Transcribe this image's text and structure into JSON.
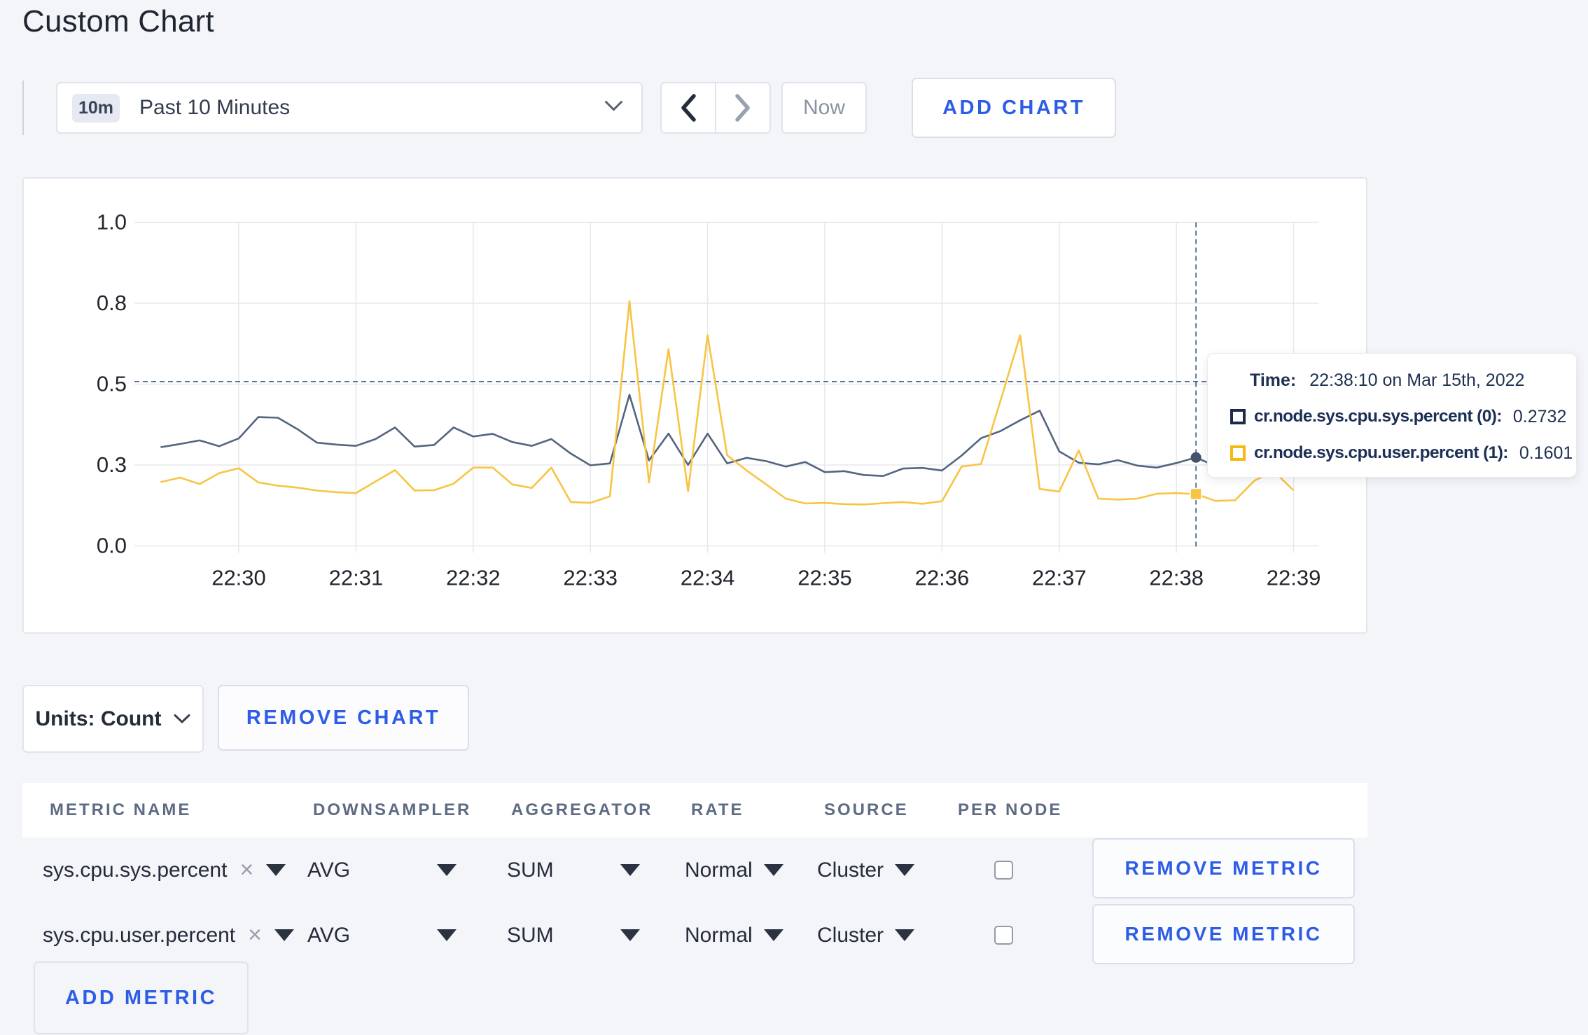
{
  "page": {
    "title": "Custom Chart"
  },
  "toolbar": {
    "range_badge": "10m",
    "range_label": "Past 10 Minutes",
    "now_label": "Now",
    "add_chart_label": "ADD CHART"
  },
  "controls": {
    "units_label": "Units: Count",
    "remove_chart_label": "REMOVE CHART",
    "add_metric_label": "ADD METRIC"
  },
  "tooltip": {
    "time_label": "Time:",
    "time_value": "22:38:10 on Mar 15th, 2022",
    "series": [
      {
        "label": "cr.node.sys.cpu.sys.percent (0):",
        "value": "0.2732",
        "swatch_color": "#1b2b4a"
      },
      {
        "label": "cr.node.sys.cpu.user.percent (1):",
        "value": "0.1601",
        "swatch_color": "#f5b912"
      }
    ]
  },
  "table": {
    "headers": [
      "METRIC NAME",
      "DOWNSAMPLER",
      "AGGREGATOR",
      "RATE",
      "SOURCE",
      "PER NODE"
    ],
    "remove_metric_label": "REMOVE METRIC",
    "rows": [
      {
        "metric": "sys.cpu.sys.percent",
        "downsampler": "AVG",
        "aggregator": "SUM",
        "rate": "Normal",
        "source": "Cluster",
        "per_node_checked": false
      },
      {
        "metric": "sys.cpu.user.percent",
        "downsampler": "AVG",
        "aggregator": "SUM",
        "rate": "Normal",
        "source": "Cluster",
        "per_node_checked": false
      }
    ]
  },
  "chart_data": {
    "type": "line",
    "title": "",
    "xlabel": "",
    "ylabel": "",
    "ylim": [
      0,
      1
    ],
    "grid": true,
    "yticks": {
      "values": [
        0,
        0.25,
        0.5,
        0.75,
        1.0
      ],
      "labels": [
        "0.0",
        "0.3",
        "0.5",
        "0.8",
        "1.0"
      ]
    },
    "xticks": [
      "22:30",
      "22:31",
      "22:32",
      "22:33",
      "22:34",
      "22:35",
      "22:36",
      "22:37",
      "22:38",
      "22:39"
    ],
    "x_times": [
      "22:29:20",
      "22:29:30",
      "22:29:40",
      "22:29:50",
      "22:30:00",
      "22:30:10",
      "22:30:20",
      "22:30:30",
      "22:30:40",
      "22:30:50",
      "22:31:00",
      "22:31:10",
      "22:31:20",
      "22:31:30",
      "22:31:40",
      "22:31:50",
      "22:32:00",
      "22:32:10",
      "22:32:20",
      "22:32:30",
      "22:32:40",
      "22:32:50",
      "22:33:00",
      "22:33:10",
      "22:33:20",
      "22:33:30",
      "22:33:40",
      "22:33:50",
      "22:34:00",
      "22:34:10",
      "22:34:20",
      "22:34:30",
      "22:34:40",
      "22:34:50",
      "22:35:00",
      "22:35:10",
      "22:35:20",
      "22:35:30",
      "22:35:40",
      "22:35:50",
      "22:36:00",
      "22:36:10",
      "22:36:20",
      "22:36:30",
      "22:36:40",
      "22:36:50",
      "22:37:00",
      "22:37:10",
      "22:37:20",
      "22:37:30",
      "22:37:40",
      "22:37:50",
      "22:38:00",
      "22:38:10",
      "22:38:20",
      "22:38:30",
      "22:38:40",
      "22:38:50",
      "22:39:00"
    ],
    "series": [
      {
        "name": "cr.node.sys.cpu.sys.percent (0)",
        "color": "#53657f",
        "values": [
          0.305,
          0.315,
          0.326,
          0.308,
          0.332,
          0.398,
          0.396,
          0.361,
          0.319,
          0.313,
          0.309,
          0.33,
          0.366,
          0.307,
          0.312,
          0.366,
          0.338,
          0.346,
          0.321,
          0.309,
          0.33,
          0.285,
          0.249,
          0.255,
          0.467,
          0.264,
          0.347,
          0.25,
          0.347,
          0.255,
          0.272,
          0.262,
          0.245,
          0.259,
          0.228,
          0.231,
          0.219,
          0.216,
          0.239,
          0.241,
          0.233,
          0.279,
          0.333,
          0.355,
          0.388,
          0.418,
          0.292,
          0.257,
          0.252,
          0.265,
          0.248,
          0.242,
          0.256,
          0.2732,
          0.247,
          0.252,
          0.268,
          0.295,
          0.31
        ]
      },
      {
        "name": "cr.node.sys.cpu.user.percent (1)",
        "color": "#f8c443",
        "values": [
          0.197,
          0.211,
          0.191,
          0.225,
          0.24,
          0.196,
          0.186,
          0.18,
          0.171,
          0.166,
          0.163,
          0.199,
          0.234,
          0.171,
          0.172,
          0.192,
          0.242,
          0.242,
          0.19,
          0.179,
          0.242,
          0.135,
          0.133,
          0.153,
          0.756,
          0.196,
          0.608,
          0.169,
          0.651,
          0.28,
          0.233,
          0.19,
          0.146,
          0.131,
          0.133,
          0.129,
          0.128,
          0.132,
          0.135,
          0.13,
          0.138,
          0.245,
          0.253,
          0.45,
          0.651,
          0.176,
          0.168,
          0.295,
          0.146,
          0.143,
          0.146,
          0.161,
          0.163,
          0.1601,
          0.139,
          0.141,
          0.202,
          0.23,
          0.171
        ]
      }
    ],
    "crosshair": {
      "x_time": "22:38:10",
      "x_index": 53,
      "y_value": 0.508,
      "color": "#41608d"
    },
    "highlight_markers": [
      {
        "series": 0,
        "index": 53,
        "shape": "circle",
        "color": "#45526e"
      },
      {
        "series": 1,
        "index": 53,
        "shape": "square",
        "color": "#f8c443"
      }
    ],
    "legend_position": "tooltip"
  }
}
